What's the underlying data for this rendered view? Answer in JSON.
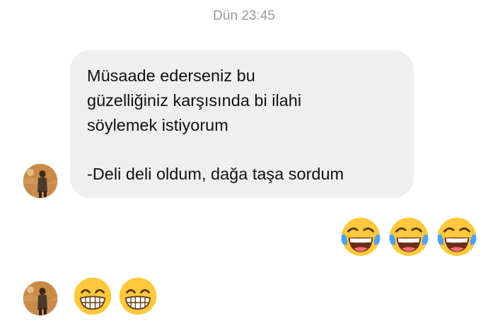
{
  "conversation": {
    "timestamp": "Dün 23:45",
    "incoming_message": {
      "lines": [
        "Müsaade ederseniz bu",
        "güzelliğiniz karşısında bi ilahi",
        "söylemek istiyorum",
        "",
        "-Deli deli oldum, dağa taşa sordum"
      ]
    },
    "outgoing_emoji_message": {
      "emojis": [
        "face-with-tears-of-joy",
        "face-with-tears-of-joy",
        "face-with-tears-of-joy"
      ]
    },
    "incoming_emoji_message": {
      "emojis": [
        "grinning-face-with-smiling-eyes",
        "grinning-face-with-smiling-eyes"
      ]
    }
  },
  "colors": {
    "background": "#ffffff",
    "incoming_bubble": "#efefef",
    "timestamp_text": "#9a9a9a",
    "message_text": "#111111",
    "emoji_yellow": "#ffc83d"
  }
}
